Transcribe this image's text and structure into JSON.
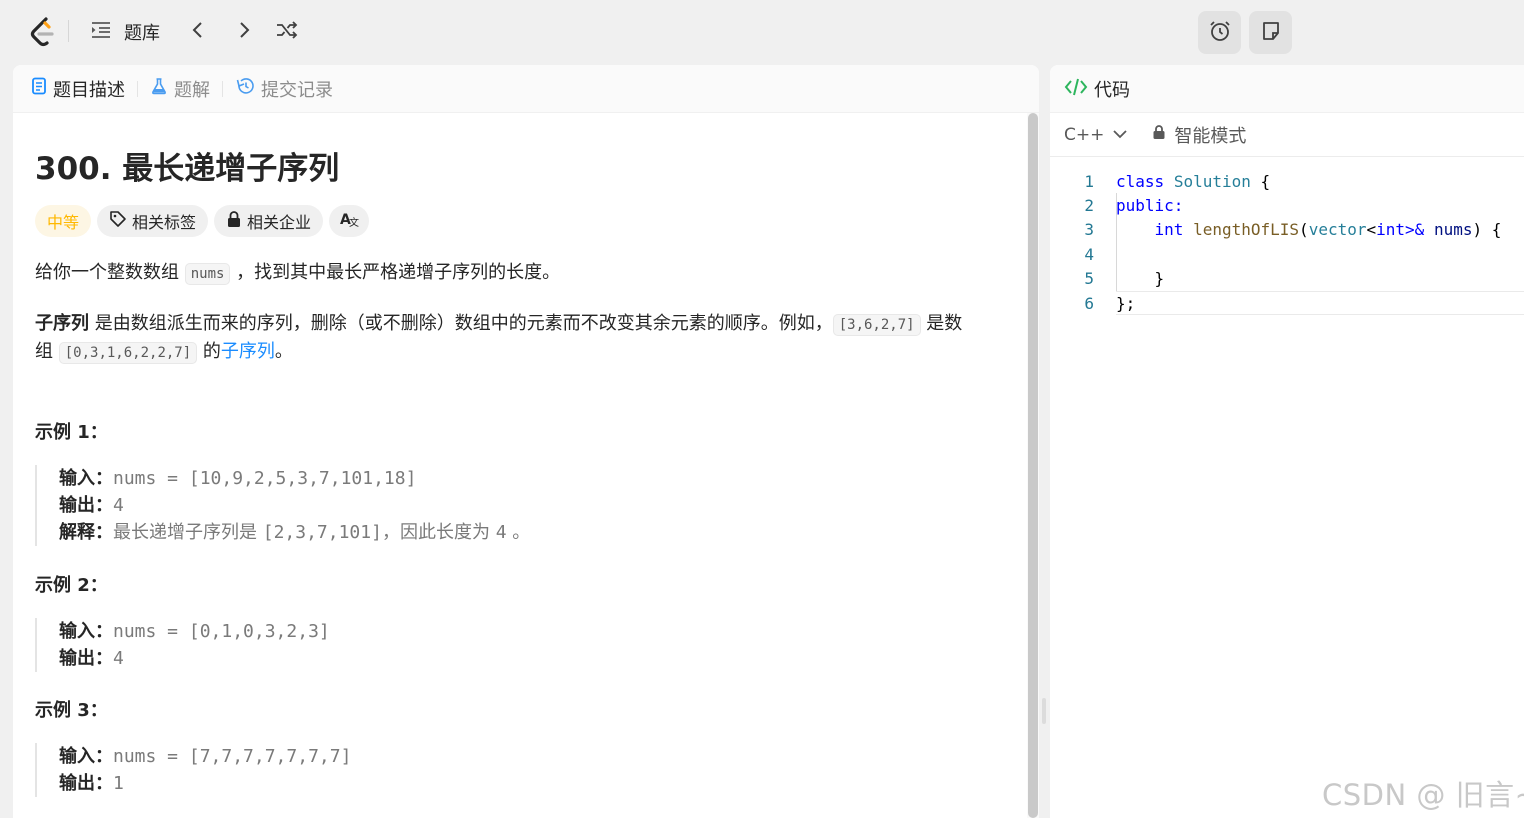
{
  "topnav": {
    "problem_list_label": "题库"
  },
  "left_panel": {
    "tabs": [
      {
        "label": "题目描述"
      },
      {
        "label": "题解"
      },
      {
        "label": "提交记录"
      }
    ],
    "problem": {
      "title": "300. 最长递增子序列",
      "difficulty": "中等",
      "tags": [
        "相关标签",
        "相关企业"
      ],
      "translate_label": "A文",
      "desc1_pre": "给你一个整数数组 ",
      "desc1_code": "nums",
      "desc1_post": " ，找到其中最长严格递增子序列的长度。",
      "desc2_bold": "子序列",
      "desc2_text": " 是由数组派生而来的序列，删除（或不删除）数组中的元素而不改变其余元素的顺序。例如，",
      "desc2_code1": "[3,6,2,7]",
      "desc2_mid": " 是数",
      "desc2_line2_pre": "组 ",
      "desc2_code2": "[0,3,1,6,2,2,7]",
      "desc2_line2_mid": " 的",
      "desc2_link": "子序列",
      "desc2_end": "。"
    },
    "examples": [
      {
        "title": "示例 1：",
        "input_label": "输入：",
        "input": "nums = [10,9,2,5,3,7,101,18]",
        "output_label": "输出：",
        "output": "4",
        "explain_label": "解释：",
        "explain_pre": "最长递增子序列是 ",
        "explain_code": "[2,3,7,101]",
        "explain_mid": "，因此长度为 ",
        "explain_num": "4",
        "explain_end": " 。"
      },
      {
        "title": "示例 2：",
        "input_label": "输入：",
        "input": "nums = [0,1,0,3,2,3]",
        "output_label": "输出：",
        "output": "4"
      },
      {
        "title": "示例 3：",
        "input_label": "输入：",
        "input": "nums = [7,7,7,7,7,7,7]",
        "output_label": "输出：",
        "output": "1"
      }
    ]
  },
  "right_panel": {
    "tab_label": "代码",
    "language": "C++",
    "mode_label": "智能模式",
    "code": {
      "line_numbers": [
        "1",
        "2",
        "3",
        "4",
        "5",
        "6"
      ],
      "l1_kw": "class",
      "l1_name": "Solution",
      "l1_rest": " {",
      "l2_kw": "public:",
      "l3_kw": "int",
      "l3_fn": "lengthOfLIS",
      "l3_p1": "(",
      "l3_ty": "vector",
      "l3_lt": "<",
      "l3_int": "int",
      "l3_gt": ">&",
      "l3_param": "nums",
      "l3_end": ") {",
      "l5": "}",
      "l6": "};"
    }
  },
  "watermark": "CSDN @ 旧言~",
  "colors": {
    "accent_link": "#1a8cff",
    "difficulty_medium": "#ffb800",
    "code_keyword": "#0000ff",
    "code_type": "#267f99",
    "line_number": "#237893"
  }
}
